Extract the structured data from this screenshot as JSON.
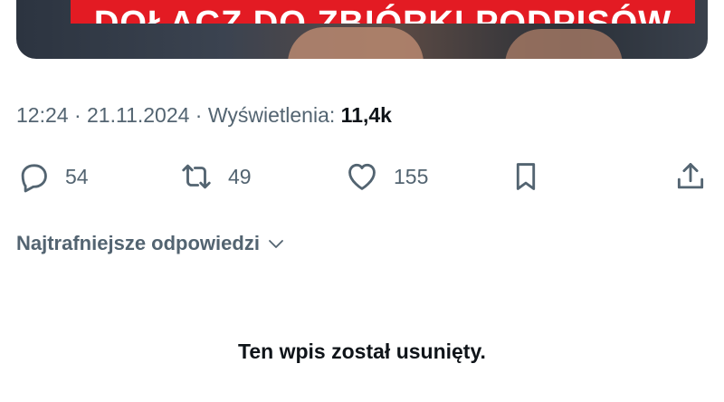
{
  "media": {
    "banner_text": "DOŁĄCZ DO ZBIÓRKI PODPISÓW",
    "banner_color": "#e31b23"
  },
  "meta": {
    "time": "12:24",
    "separator": " · ",
    "date": "21.11.2024",
    "views_label": "Wyświetlenia: ",
    "views_count": "11,4k"
  },
  "actions": {
    "reply": {
      "icon": "reply-icon",
      "count": "54"
    },
    "repost": {
      "icon": "repost-icon",
      "count": "49"
    },
    "like": {
      "icon": "heart-icon",
      "count": "155"
    },
    "bookmark": {
      "icon": "bookmark-icon"
    },
    "share": {
      "icon": "share-icon"
    }
  },
  "replies": {
    "sort_label": "Najtrafniejsze odpowiedzi",
    "deleted_notice": "Ten wpis został usunięty."
  },
  "colors": {
    "secondary_text": "#536471",
    "primary_text": "#0f1419"
  }
}
